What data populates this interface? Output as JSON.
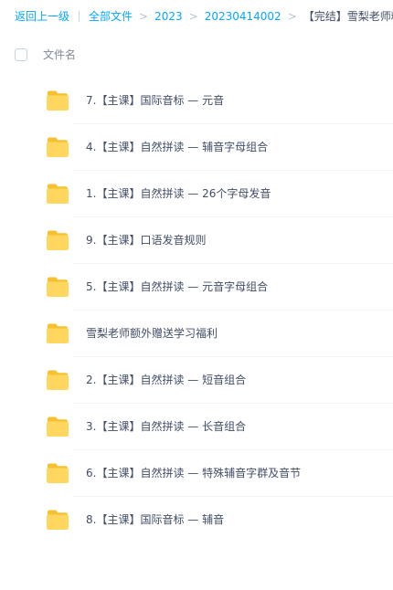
{
  "breadcrumb": {
    "back": "返回上一级",
    "all_files": "全部文件",
    "level1": "2023",
    "level2": "20230414002",
    "current": "【完结】雪梨老师精..."
  },
  "header": {
    "column_name": "文件名"
  },
  "files": [
    {
      "name": "7.【主课】国际音标 — 元音",
      "icon": "folder-icon"
    },
    {
      "name": "4.【主课】自然拼读 — 辅音字母组合",
      "icon": "folder-icon"
    },
    {
      "name": "1.【主课】自然拼读 — 26个字母发音",
      "icon": "folder-icon"
    },
    {
      "name": "9.【主课】口语发音规则",
      "icon": "folder-icon"
    },
    {
      "name": "5.【主课】自然拼读 — 元音字母组合",
      "icon": "folder-icon"
    },
    {
      "name": "雪梨老师额外赠送学习福利",
      "icon": "folder-icon"
    },
    {
      "name": "2.【主课】自然拼读 — 短音组合",
      "icon": "folder-icon"
    },
    {
      "name": "3.【主课】自然拼读 — 长音组合",
      "icon": "folder-icon"
    },
    {
      "name": "6.【主课】自然拼读 — 特殊辅音字群及音节",
      "icon": "folder-icon"
    },
    {
      "name": "8.【主课】国际音标 — 辅音",
      "icon": "folder-icon"
    }
  ],
  "colors": {
    "link": "#06a7ff",
    "text": "#424e67",
    "muted": "#818999",
    "folder_back": "#f7c02f",
    "folder_front": "#ffd75e"
  }
}
